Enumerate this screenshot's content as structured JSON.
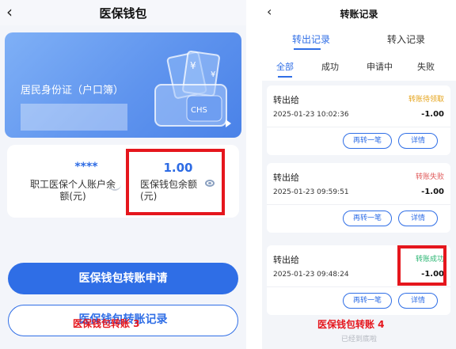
{
  "left": {
    "title": "医保钱包",
    "card": {
      "label": "居民身份证（户口簿）"
    },
    "balance_left": {
      "value": "****",
      "label": "职工医保个人账户余额(元)"
    },
    "balance_right": {
      "value": "1.00",
      "label": "医保钱包余额(元)"
    },
    "primary_button": "医保钱包转账申请",
    "secondary_button": "医保钱包转账记录",
    "watermark": "医保钱包转账 3"
  },
  "right": {
    "title": "转账记录",
    "tabs": [
      {
        "label": "转出记录"
      },
      {
        "label": "转入记录"
      }
    ],
    "filters": [
      {
        "label": "全部"
      },
      {
        "label": "成功"
      },
      {
        "label": "申请中"
      },
      {
        "label": "失败"
      }
    ],
    "records": [
      {
        "title": "转出给",
        "status": "转账待领取",
        "time": "2025-01-23 10:02:36",
        "amount": "-1.00",
        "again": "再转一笔",
        "detail": "详情"
      },
      {
        "title": "转出给",
        "status": "转账失败",
        "time": "2025-01-23 09:59:51",
        "amount": "-1.00",
        "again": "再转一笔",
        "detail": "详情"
      },
      {
        "title": "转出给",
        "status": "转账成功",
        "time": "2025-01-23 09:48:24",
        "amount": "-1.00",
        "again": "再转一笔",
        "detail": "详情"
      }
    ],
    "end_text": "已经到底啦",
    "watermark": "医保钱包转账 4"
  },
  "colors": {
    "primary": "#2f6ee6",
    "status_pending": "#e5a319",
    "status_failed": "#e05a5a",
    "status_success": "#2bb673",
    "highlight": "#e5161d"
  }
}
